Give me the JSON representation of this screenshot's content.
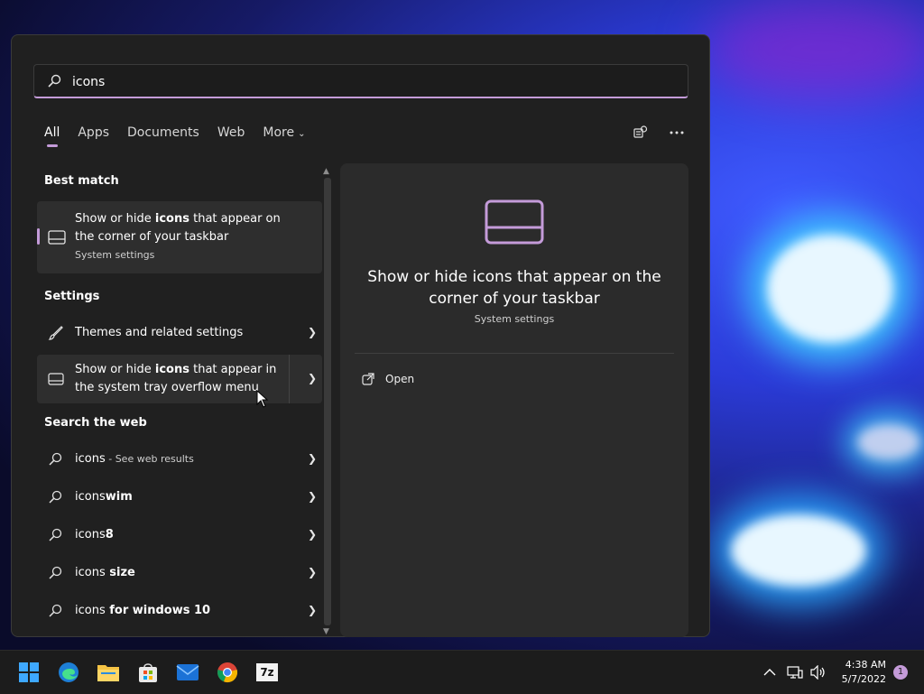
{
  "search": {
    "value": "icons",
    "placeholder": ""
  },
  "tabs": [
    {
      "label": "All"
    },
    {
      "label": "Apps"
    },
    {
      "label": "Documents"
    },
    {
      "label": "Web"
    },
    {
      "label": "More"
    }
  ],
  "sections": {
    "best_match": "Best match",
    "settings": "Settings",
    "web": "Search the web"
  },
  "best_match": {
    "line1_pre": "Show or hide ",
    "line1_bold": "icons",
    "line1_post": " that appear on",
    "line2": "the corner of your taskbar",
    "sub": "System settings"
  },
  "settings_items": [
    {
      "label": "Themes and related settings"
    },
    {
      "line1_pre": "Show or hide ",
      "line1_bold": "icons",
      "line1_post": " that appear in",
      "line2": "the system tray overflow menu"
    }
  ],
  "web_items": [
    {
      "plain": "icons",
      "bold": "",
      "suffix": " - See web results"
    },
    {
      "plain": "icons",
      "bold": "wim",
      "suffix": ""
    },
    {
      "plain": "icons",
      "bold": "8",
      "suffix": ""
    },
    {
      "plain": "icons",
      "bold": " size",
      "suffix": ""
    },
    {
      "plain": "icons",
      "bold": " for windows 10",
      "suffix": ""
    }
  ],
  "detail": {
    "title": "Show or hide icons that appear on the corner of your taskbar",
    "subtitle": "System settings",
    "open_label": "Open"
  },
  "taskbar": {
    "time": "4:38 AM",
    "date": "5/7/2022",
    "notifications": "1",
    "zip_label": "7z"
  },
  "colors": {
    "accent": "#c49bd9",
    "panel": "#202020",
    "detail": "#2b2b2b"
  }
}
